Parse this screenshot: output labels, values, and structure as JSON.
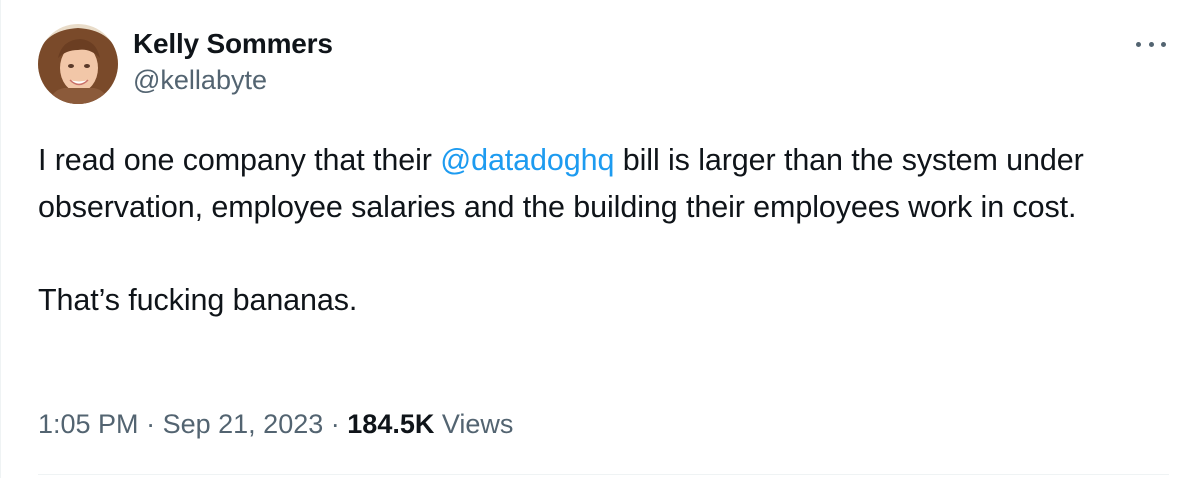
{
  "author": {
    "display_name": "Kelly Sommers",
    "handle": "@kellabyte"
  },
  "tweet": {
    "text_part1": "I read one company that their ",
    "mention": "@datadoghq",
    "text_part2": " bill is larger than the system under observation, employee salaries and the building their employees work in cost.",
    "paragraph2": "That’s fucking bananas."
  },
  "meta": {
    "time": "1:05 PM",
    "separator": "·",
    "date": "Sep 21, 2023",
    "views_count": "184.5K",
    "views_label": "Views"
  },
  "icons": {
    "more": "more-horizontal-icon"
  },
  "colors": {
    "text_primary": "#0f1419",
    "text_secondary": "#536471",
    "link": "#1d9bf0",
    "divider": "#eff3f4"
  }
}
